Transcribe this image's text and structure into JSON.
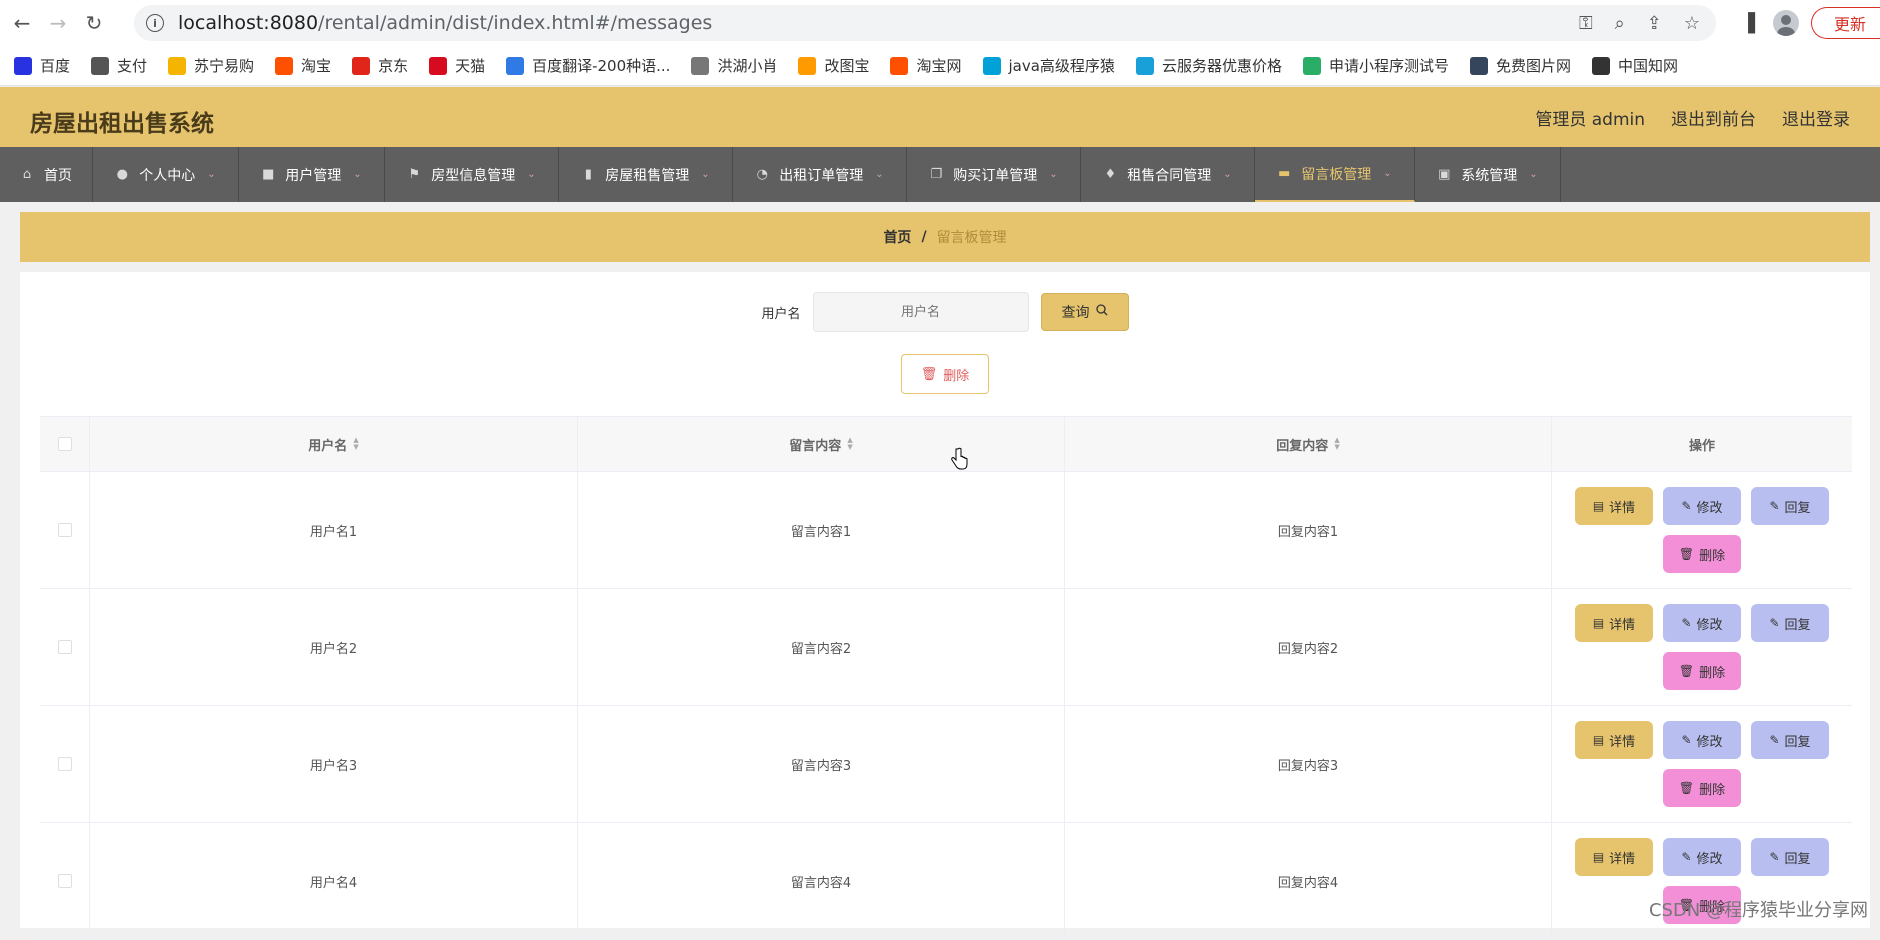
{
  "browser": {
    "url_host": "localhost:8080",
    "url_path": "/rental/admin/dist/index.html#/messages",
    "update_label": "更新",
    "bookmarks": [
      {
        "label": "百度",
        "icon": "baidu-icon",
        "color": "#2932e1"
      },
      {
        "label": "支付",
        "icon": "globe-icon",
        "color": "#555555"
      },
      {
        "label": "苏宁易购",
        "icon": "suning-icon",
        "color": "#f5b400"
      },
      {
        "label": "淘宝",
        "icon": "taobao-icon",
        "color": "#ff5000"
      },
      {
        "label": "京东",
        "icon": "jd-icon",
        "color": "#e1251b"
      },
      {
        "label": "天猫",
        "icon": "tmall-icon",
        "color": "#d70b1f"
      },
      {
        "label": "百度翻译-200种语...",
        "icon": "translate-icon",
        "color": "#2f7ae5"
      },
      {
        "label": "洪湖小肖",
        "icon": "bird-icon",
        "color": "#777777"
      },
      {
        "label": "改图宝",
        "icon": "image-icon",
        "color": "#ff9a00"
      },
      {
        "label": "淘宝网",
        "icon": "taobao-icon",
        "color": "#ff5000"
      },
      {
        "label": "java高级程序猿",
        "icon": "bilibili-icon",
        "color": "#00a1d6"
      },
      {
        "label": "云服务器优惠价格",
        "icon": "cloud-icon",
        "color": "#1aa0d8"
      },
      {
        "label": "申请小程序测试号",
        "icon": "wechat-icon",
        "color": "#2aae67"
      },
      {
        "label": "免费图片网",
        "icon": "t-icon",
        "color": "#35465c"
      },
      {
        "label": "中国知网",
        "icon": "cnki-icon",
        "color": "#333333"
      }
    ]
  },
  "header": {
    "title": "房屋出租出售系统",
    "admin_label": "管理员 admin",
    "to_front_label": "退出到前台",
    "logout_label": "退出登录"
  },
  "nav": [
    {
      "label": "首页",
      "name": "nav-home",
      "icon": "home-icon",
      "glyph": "⌂",
      "width": 93,
      "caret": false,
      "active": false
    },
    {
      "label": "个人中心",
      "name": "nav-personal-center",
      "icon": "user-icon",
      "glyph": "●",
      "width": 146,
      "caret": true,
      "active": false
    },
    {
      "label": "用户管理",
      "name": "nav-user-management",
      "icon": "briefcase-icon",
      "glyph": "■",
      "width": 146,
      "caret": true,
      "active": false
    },
    {
      "label": "房型信息管理",
      "name": "nav-room-type-management",
      "icon": "flag-icon",
      "glyph": "⚑",
      "width": 174,
      "caret": true,
      "active": false
    },
    {
      "label": "房屋租售管理",
      "name": "nav-house-rental-management",
      "icon": "bar-chart-icon",
      "glyph": "▮",
      "width": 174,
      "caret": true,
      "active": false
    },
    {
      "label": "出租订单管理",
      "name": "nav-rental-order-management",
      "icon": "compass-icon",
      "glyph": "◔",
      "width": 174,
      "caret": true,
      "active": false
    },
    {
      "label": "购买订单管理",
      "name": "nav-purchase-order-management",
      "icon": "copy-icon",
      "glyph": "❐",
      "width": 174,
      "caret": true,
      "active": false
    },
    {
      "label": "租售合同管理",
      "name": "nav-contract-management",
      "icon": "mic-icon",
      "glyph": "♦",
      "width": 174,
      "caret": true,
      "active": false
    },
    {
      "label": "留言板管理",
      "name": "nav-message-board-management",
      "icon": "monitor-icon",
      "glyph": "▬",
      "width": 160,
      "caret": true,
      "active": true
    },
    {
      "label": "系统管理",
      "name": "nav-system-management",
      "icon": "chart-icon",
      "glyph": "▣",
      "width": 146,
      "caret": true,
      "active": false
    }
  ],
  "breadcrumb": {
    "home": "首页",
    "separator": "/",
    "current": "留言板管理"
  },
  "search": {
    "label": "用户名",
    "placeholder": "用户名",
    "button_label": "查询"
  },
  "batch_delete_label": "删除",
  "table": {
    "columns": [
      "用户名",
      "留言内容",
      "回复内容",
      "操作"
    ],
    "action_labels": {
      "detail": "详情",
      "edit": "修改",
      "reply": "回复",
      "delete": "删除"
    },
    "rows": [
      {
        "username": "用户名1",
        "content": "留言内容1",
        "reply": "回复内容1"
      },
      {
        "username": "用户名2",
        "content": "留言内容2",
        "reply": "回复内容2"
      },
      {
        "username": "用户名3",
        "content": "留言内容3",
        "reply": "回复内容3"
      },
      {
        "username": "用户名4",
        "content": "留言内容4",
        "reply": "回复内容4"
      }
    ]
  },
  "watermark": "CSDN @程序猿毕业分享网",
  "colors": {
    "accent": "#e6c46e",
    "nav_bg": "#5f5f5f",
    "edit_btn": "#b8bff0",
    "delete_btn": "#f28fd6"
  }
}
